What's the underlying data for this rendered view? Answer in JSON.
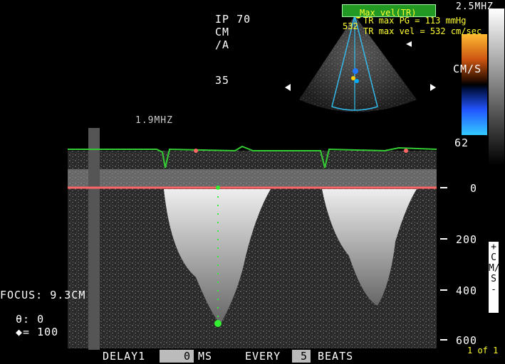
{
  "header": {
    "left_lines": [
      "IP 70",
      "CM",
      "/A",
      "35"
    ],
    "frequency_label": "2.5MHZ",
    "doppler_freq_label": "1.9MHZ"
  },
  "measurement": {
    "title": "Max vel(TR) 532",
    "pg_line": "TR max PG = 113 mmHg",
    "vel_line": "TR max vel = 532 cm/sec"
  },
  "color_bar": {
    "top_label": "62",
    "units_label": "CM/S"
  },
  "doppler": {
    "scale_ticks": [
      "0",
      "200",
      "400",
      "600"
    ],
    "scale_units": "+CM/S-",
    "focus_label": "FOCUS: 9.3CM",
    "theta_label": "θ: 0",
    "gain_label": "◆= 100"
  },
  "footer": {
    "delay_label": "DELAY1",
    "delay_value": "0",
    "delay_units": "MS",
    "every_label": "EVERY",
    "every_value": "5",
    "beats_label": "BEATS",
    "page_indicator": "1 of 1"
  },
  "colors": {
    "ecg": "#33cc33",
    "baseline": "#ff6666",
    "measure": "#33ee33",
    "label_yellow": "#ffff33",
    "measure_box": "#229922"
  }
}
